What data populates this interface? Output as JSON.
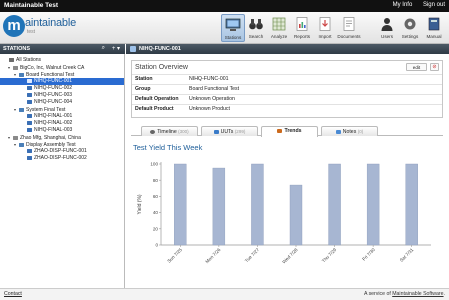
{
  "app": {
    "title": "Maintainable Test",
    "links": [
      "My Info",
      "Sign out"
    ]
  },
  "logo": {
    "letter": "m",
    "word": "aintainable",
    "sub": "test"
  },
  "toolbar": {
    "items": [
      {
        "label": "Stations",
        "icon": "stations-icon",
        "active": true
      },
      {
        "label": "Search",
        "icon": "binoculars-icon"
      },
      {
        "label": "Analyze",
        "icon": "grid-icon"
      },
      {
        "label": "Reports",
        "icon": "report-icon"
      },
      {
        "label": "Import",
        "icon": "import-icon"
      },
      {
        "label": "Documents",
        "icon": "document-icon"
      },
      {
        "label": "Users",
        "icon": "users-icon"
      },
      {
        "label": "Settings",
        "icon": "gear-icon"
      },
      {
        "label": "Manual",
        "icon": "manual-icon"
      }
    ]
  },
  "stations": {
    "header": "STATIONS",
    "search_icon": "⌕",
    "add_icon": "+ ▾",
    "tree": [
      {
        "label": "All Stations",
        "level": 0,
        "icon": "home-icon",
        "expanded": false
      },
      {
        "label": "BigCo, Inc, Walnut Creek CA",
        "level": 1,
        "icon": "company-icon",
        "expanded": true
      },
      {
        "label": "Board Functional Test",
        "level": 2,
        "icon": "folder-icon",
        "expanded": true
      },
      {
        "label": "NIHQ-FUNC-001",
        "level": 3,
        "icon": "station-icon",
        "selected": true
      },
      {
        "label": "NIHQ-FUNC-002",
        "level": 3,
        "icon": "station-icon"
      },
      {
        "label": "NIHQ-FUNC-003",
        "level": 3,
        "icon": "station-icon"
      },
      {
        "label": "NIHQ-FUNC-004",
        "level": 3,
        "icon": "station-icon"
      },
      {
        "label": "System Final Test",
        "level": 2,
        "icon": "folder-icon",
        "expanded": true
      },
      {
        "label": "NIHQ-FINAL-001",
        "level": 3,
        "icon": "station-icon"
      },
      {
        "label": "NIHQ-FINAL-002",
        "level": 3,
        "icon": "station-icon"
      },
      {
        "label": "NIHQ-FINAL-003",
        "level": 3,
        "icon": "station-icon"
      },
      {
        "label": "Zhao Mfg, Shanghai, China",
        "level": 1,
        "icon": "company-icon",
        "expanded": true
      },
      {
        "label": "Display Assembly Test",
        "level": 2,
        "icon": "folder-icon",
        "expanded": true
      },
      {
        "label": "ZHAO-DISP-FUNC-001",
        "level": 3,
        "icon": "station-icon"
      },
      {
        "label": "ZHAO-DISP-FUNC-002",
        "level": 3,
        "icon": "station-icon"
      }
    ]
  },
  "main": {
    "station_name": "NIHQ-FUNC-001",
    "overview": {
      "title": "Station Overview",
      "edit_label": "edit",
      "close_icon": "⊘",
      "rows": [
        {
          "key": "Station",
          "value": "NIHQ-FUNC-001"
        },
        {
          "key": "Group",
          "value": "Board Functional Test"
        },
        {
          "key": "Default Operation",
          "value": "Unknown Operation"
        },
        {
          "key": "Default Product",
          "value": "Unknown Product"
        }
      ]
    },
    "tabs": [
      {
        "label": "Timeline",
        "count": "(300)",
        "color": "#666"
      },
      {
        "label": "UUTs",
        "count": "(299)",
        "color": "#3a7bc8"
      },
      {
        "label": "Trends",
        "count": "",
        "color": "#cc6a1d",
        "active": true
      },
      {
        "label": "Notes",
        "count": "(0)",
        "color": "#4a8ad3"
      }
    ]
  },
  "chart_data": {
    "type": "bar",
    "title": "Test Yield This Week",
    "xlabel": "",
    "ylabel": "Yield (%)",
    "ylim": [
      0,
      100
    ],
    "yticks": [
      0,
      20,
      40,
      60,
      80,
      100
    ],
    "categories": [
      "Sun 7/25",
      "Mon 7/26",
      "Tue 7/27",
      "Wed 7/28",
      "Thu 7/29",
      "Fri 7/30",
      "Sat 7/31"
    ],
    "values": [
      100,
      95,
      100,
      74,
      100,
      100,
      100
    ],
    "bar_color": "#a7b6d2",
    "grid": false
  },
  "footer": {
    "contact": "Contact",
    "credit_prefix": "A service of ",
    "credit_link": "Maintainable Software",
    "credit_suffix": "."
  }
}
